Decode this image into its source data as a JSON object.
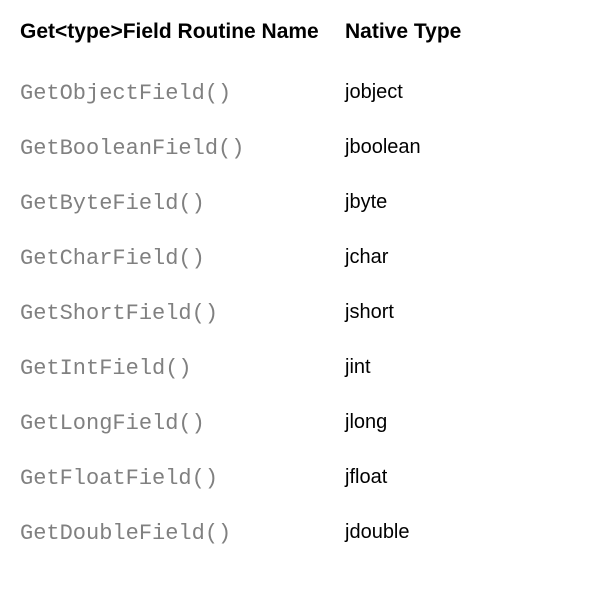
{
  "headers": {
    "routine": "Get<type>Field Routine Name",
    "native": "Native Type"
  },
  "rows": [
    {
      "routine": "GetObjectField()",
      "native": "jobject"
    },
    {
      "routine": "GetBooleanField()",
      "native": "jboolean"
    },
    {
      "routine": "GetByteField()",
      "native": "jbyte"
    },
    {
      "routine": "GetCharField()",
      "native": "jchar"
    },
    {
      "routine": "GetShortField()",
      "native": "jshort"
    },
    {
      "routine": "GetIntField()",
      "native": "jint"
    },
    {
      "routine": "GetLongField()",
      "native": "jlong"
    },
    {
      "routine": "GetFloatField()",
      "native": "jfloat"
    },
    {
      "routine": "GetDoubleField()",
      "native": "jdouble"
    }
  ]
}
